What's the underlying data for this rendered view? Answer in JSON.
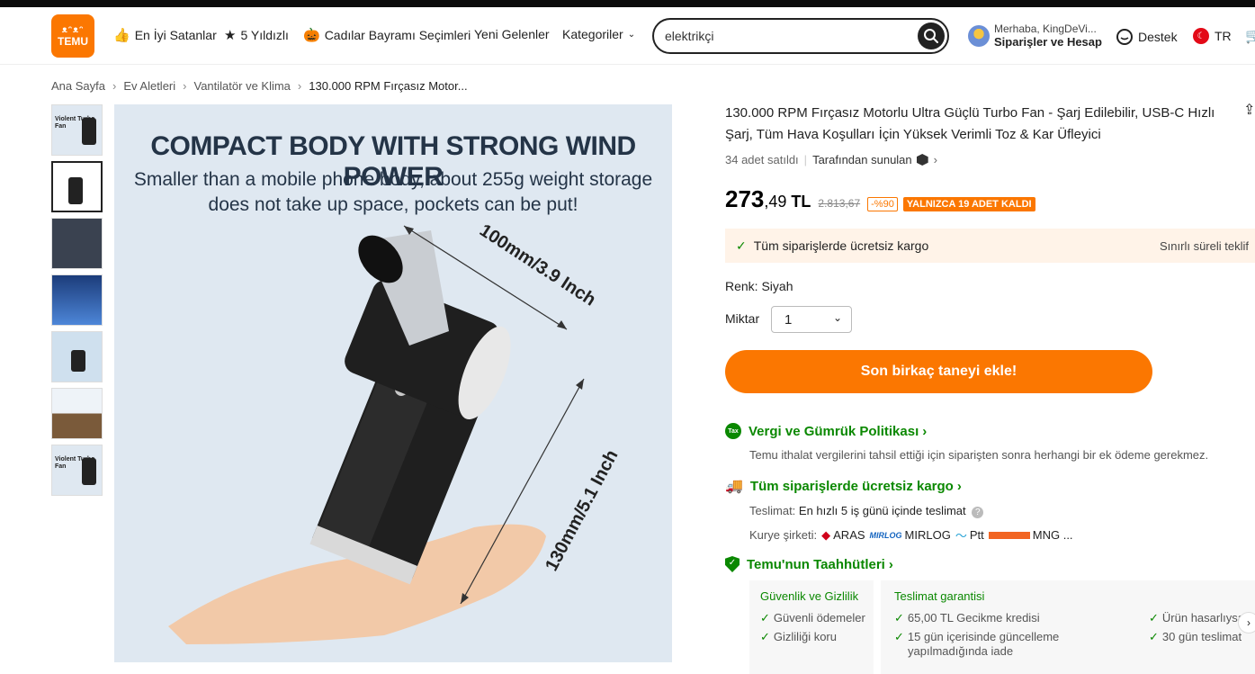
{
  "header": {
    "logo_text": "TEMU",
    "logo_glyphs": "ᴥᵔᴥᵔ",
    "nav": [
      {
        "label": "En İyi Satanlar",
        "icon": "thumbs-up-icon"
      },
      {
        "label": "5 Yıldızlı",
        "icon": "star-badge-icon"
      },
      {
        "label": "Cadılar Bayramı Seçimleri",
        "icon": "pumpkin-icon"
      },
      {
        "label": "Yeni Gelenler"
      },
      {
        "label": "Kategoriler"
      }
    ],
    "search_value": "elektrikçi",
    "account_greeting": "Merhaba, KingDeVi...",
    "account_label": "Siparişler ve Hesap",
    "support_label": "Destek",
    "language": "TR"
  },
  "breadcrumb": [
    "Ana Sayfa",
    "Ev Aletleri",
    "Vantilatör ve Klima",
    "130.000 RPM Fırçasız Motor..."
  ],
  "gallery": {
    "main_image_title": "COMPACT BODY WITH STRONG WIND POWER",
    "main_image_sub1": "Smaller than a mobile phone body, about 255g weight storage",
    "main_image_sub2": "does not take up space, pockets can be put!",
    "dim_length": "100mm/3.9 Inch",
    "dim_height": "130mm/5.1 Inch",
    "thumb_label": "Violent Turbo Fan"
  },
  "product": {
    "title": "130.000 RPM Fırçasız Motorlu Ultra Güçlü Turbo Fan - Şarj Edilebilir, USB-C Hızlı Şarj, Tüm Hava Koşulları İçin Yüksek Verimli Toz & Kar Üfleyici",
    "sold": "34 adet satıldı",
    "seller": "Tarafından sunulan",
    "price_int": "273",
    "price_dec": ",49",
    "currency": "TL",
    "old_price": "2.813,67",
    "discount": "-%90",
    "stock_badge": "YALNIZCA 19 ADET KALDI",
    "shipping_banner": "Tüm siparişlerde ücretsiz kargo",
    "shipping_banner_right": "Sınırlı süreli teklif",
    "color_label": "Renk: Siyah",
    "qty_label": "Miktar",
    "qty_value": "1",
    "add_button": "Son birkaç taneyi ekle!"
  },
  "sections": {
    "tax_title": "Vergi ve Gümrük Politikası",
    "tax_body": "Temu ithalat vergilerini tahsil ettiği için siparişten sonra herhangi bir ek ödeme gerekmez.",
    "tax_badge": "Tax",
    "ship_title": "Tüm siparişlerde ücretsiz kargo",
    "delivery_label": "Teslimat:",
    "delivery_value": "En hızlı  5 iş günü içinde teslimat",
    "courier_label": "Kurye şirketi:",
    "couriers": [
      "ARAS",
      "MIRLOG",
      "Ptt",
      "MNG ..."
    ],
    "commit_title": "Temu'nun Taahhütleri",
    "commit_cols": [
      {
        "heading": "Güvenlik ve Gizlilik",
        "items": [
          "Güvenli ödemeler",
          "Gizliliği koru"
        ]
      },
      {
        "heading": "Teslimat garantisi",
        "items": [
          "65,00 TL Gecikme kredisi",
          "15 gün içerisinde güncelleme",
          "yapılmadığında iade"
        ]
      },
      {
        "heading": "",
        "items": [
          "Ürün hasarlıysa",
          "30 gün teslimat"
        ]
      }
    ]
  },
  "colors": {
    "accent": "#fb7701",
    "success": "#0a8800"
  }
}
